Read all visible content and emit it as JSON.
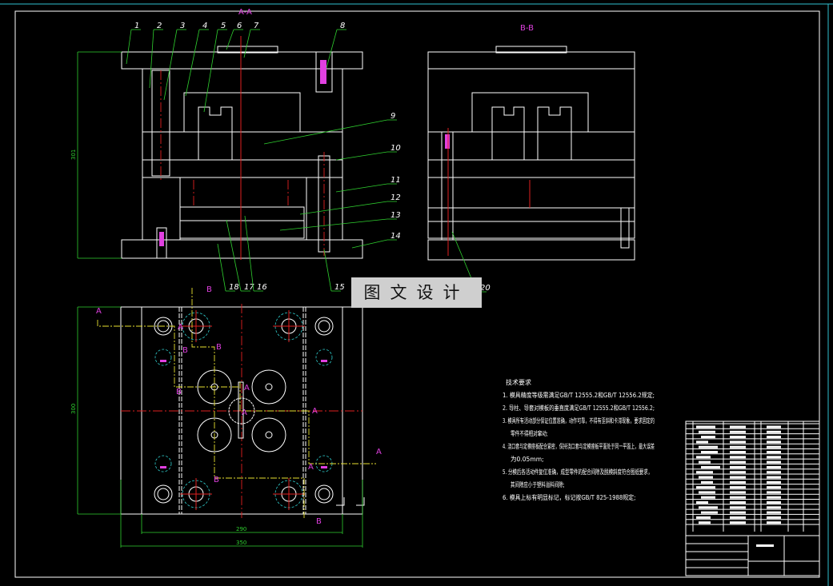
{
  "drawing": {
    "section_aa_title": "A-A",
    "section_bb_title": "B-B",
    "part_labels_top": [
      "1",
      "2",
      "3",
      "4",
      "5",
      "6",
      "7",
      "8"
    ],
    "part_labels_right": [
      "9",
      "10",
      "11",
      "12",
      "13",
      "14"
    ],
    "part_labels_bottom": [
      "18",
      "17",
      "16",
      "15"
    ],
    "part_labels_bb": [
      "20"
    ],
    "dimensions": {
      "height_aa": "301",
      "plan_height": "300",
      "inner_width": "290",
      "outer_width": "350"
    },
    "plan_markers": [
      "A",
      "A",
      "B",
      "B",
      "B",
      "A",
      "A",
      "A",
      "A",
      "B",
      "B",
      "A",
      "B"
    ],
    "colors": {
      "background": "#000000",
      "hatch": "#2fd02f",
      "section_marker": "#e040e0",
      "centerline": "#e02020",
      "cut_line": "#e8e030"
    }
  },
  "watermark": "图文设计",
  "tech_requirements": {
    "title": "技术要求",
    "lines": [
      "1. 模具精度等级需满足GB/T 12555.2和GB/T 12556.2规定;",
      "2. 导柱、导套对模板的垂直度满足GB/T 12555.2和GB/T 12556.2;",
      "3. 模具所有活动部分保证位置准确，动作可靠，不得有歪斜和卡滞现象，要求固定的",
      "零件不得相对窜动;",
      "4. 浇口套与定模座板配合紧密，保持浇口套与定模座板平面处于同一平面上，最大误差",
      "为0.05mm;",
      "5. 分模后各活动件复位准确，成型零件的配合间隙及脱模斜度符合图纸要求，",
      "其间隙应小于塑料溢料间隙;",
      "6. 模具上标有明显标记，标记按GB/T 825-1988规定;"
    ]
  }
}
